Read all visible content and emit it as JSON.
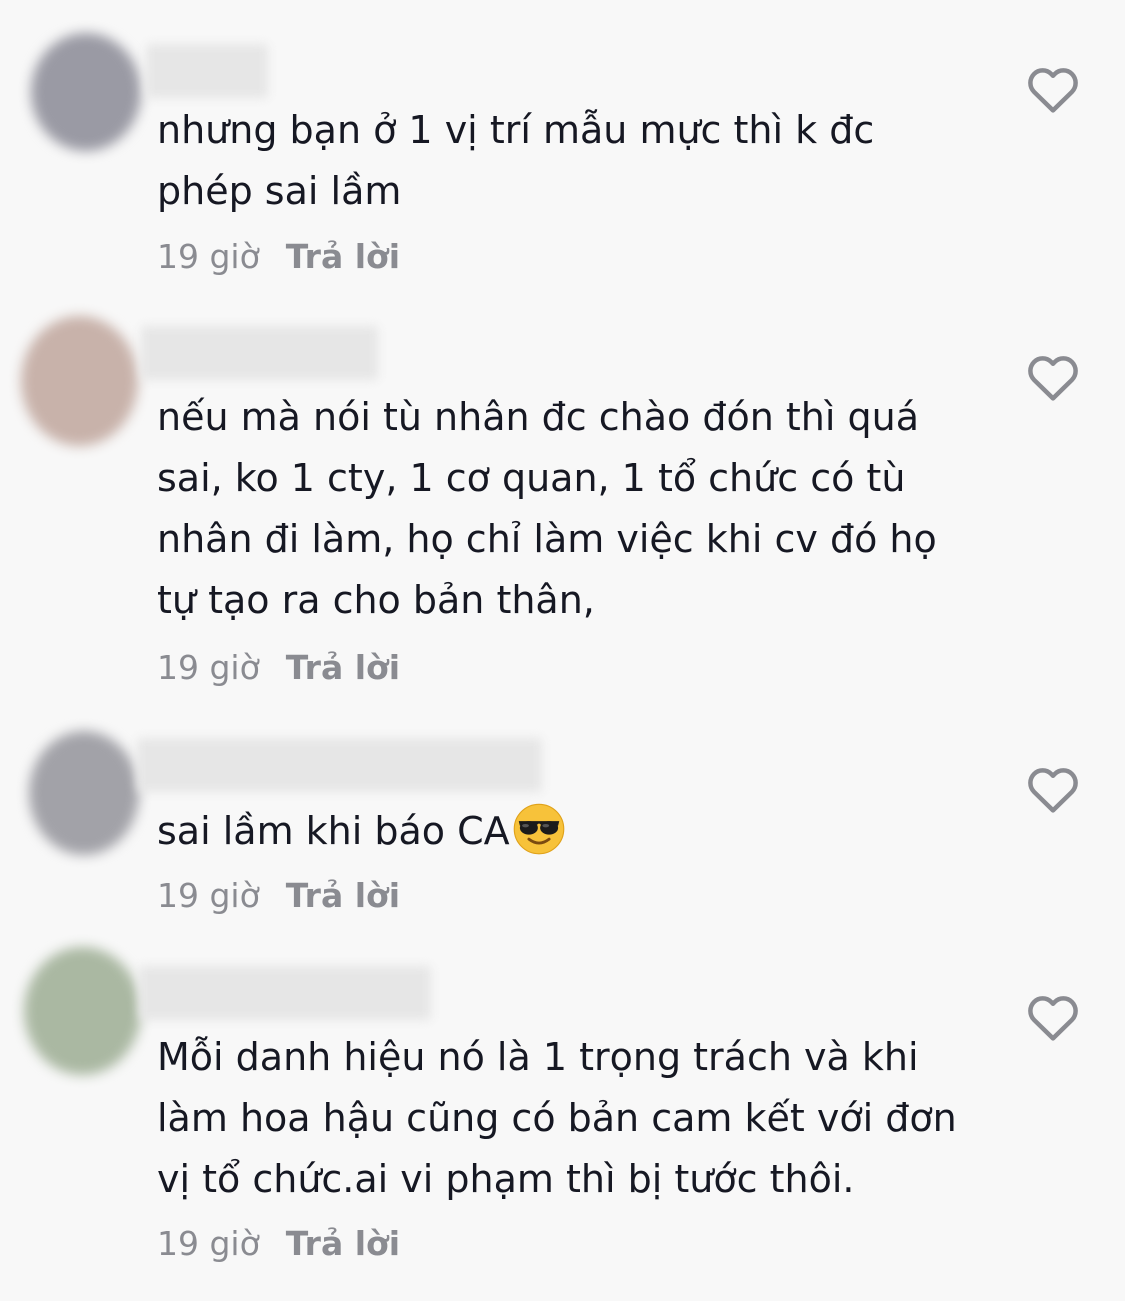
{
  "comments": [
    {
      "text": "nhưng bạn ở 1 vị trí mẫu mực thì k đc phép sai lầm",
      "time": "19 giờ",
      "reply_label": "Trả lời",
      "avatar_color": "#9a9aa4",
      "like_icon": "heart-outline-icon"
    },
    {
      "text": "nếu mà nói tù nhân đc chào đón thì quá sai, ko 1 cty, 1 cơ quan, 1 tổ chức có tù nhân đi làm, họ chỉ làm việc khi cv đó họ tự tạo ra cho bản thân,",
      "time": "19 giờ",
      "reply_label": "Trả lời",
      "avatar_color": "#c8b2aa",
      "like_icon": "heart-outline-icon"
    },
    {
      "text": "sai lầm khi báo CA",
      "emoji": "smiling-face-with-sunglasses",
      "time": "19 giờ",
      "reply_label": "Trả lời",
      "avatar_color": "#a2a2a8",
      "like_icon": "heart-outline-icon"
    },
    {
      "text": "Mỗi danh hiệu nó là 1 trọng trách và khi làm hoa hậu cũng có bản cam kết với đơn vị tổ chức.ai vi phạm thì bị tước thôi.",
      "time": "19 giờ",
      "reply_label": "Trả lời",
      "avatar_color": "#aab8a2",
      "like_icon": "heart-outline-icon"
    }
  ]
}
